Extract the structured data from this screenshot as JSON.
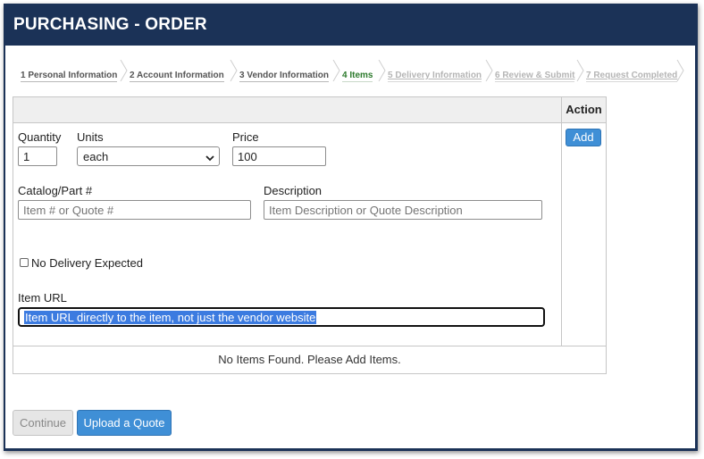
{
  "page": {
    "title": "PURCHASING - ORDER"
  },
  "steps": [
    {
      "label": "1 Personal Information",
      "state": "done"
    },
    {
      "label": "2 Account Information",
      "state": "done"
    },
    {
      "label": "3 Vendor Information",
      "state": "done"
    },
    {
      "label": "4 Items",
      "state": "current"
    },
    {
      "label": "5 Delivery Information",
      "state": "future"
    },
    {
      "label": "6 Review & Submit",
      "state": "future"
    },
    {
      "label": "7 Request Completed",
      "state": "future"
    }
  ],
  "table": {
    "action_header": "Action",
    "add_label": "Add",
    "empty_message": "No Items Found. Please Add Items."
  },
  "form": {
    "quantity_label": "Quantity",
    "quantity_value": "1",
    "units_label": "Units",
    "units_value": "each",
    "price_label": "Price",
    "price_value": "100",
    "catalog_label": "Catalog/Part #",
    "catalog_placeholder": "Item # or Quote #",
    "description_label": "Description",
    "description_placeholder": "Item Description or Quote Description",
    "no_delivery_label": "No Delivery Expected",
    "item_url_label": "Item URL",
    "item_url_value": "Item URL directly to the item, not just the vendor website"
  },
  "buttons": {
    "continue_label": "Continue",
    "upload_label": "Upload a Quote"
  },
  "colors": {
    "header_bg": "#1b3257",
    "primary_button": "#3f8fd6",
    "current_step": "#2c7a2c",
    "selection": "#3c7be0"
  }
}
